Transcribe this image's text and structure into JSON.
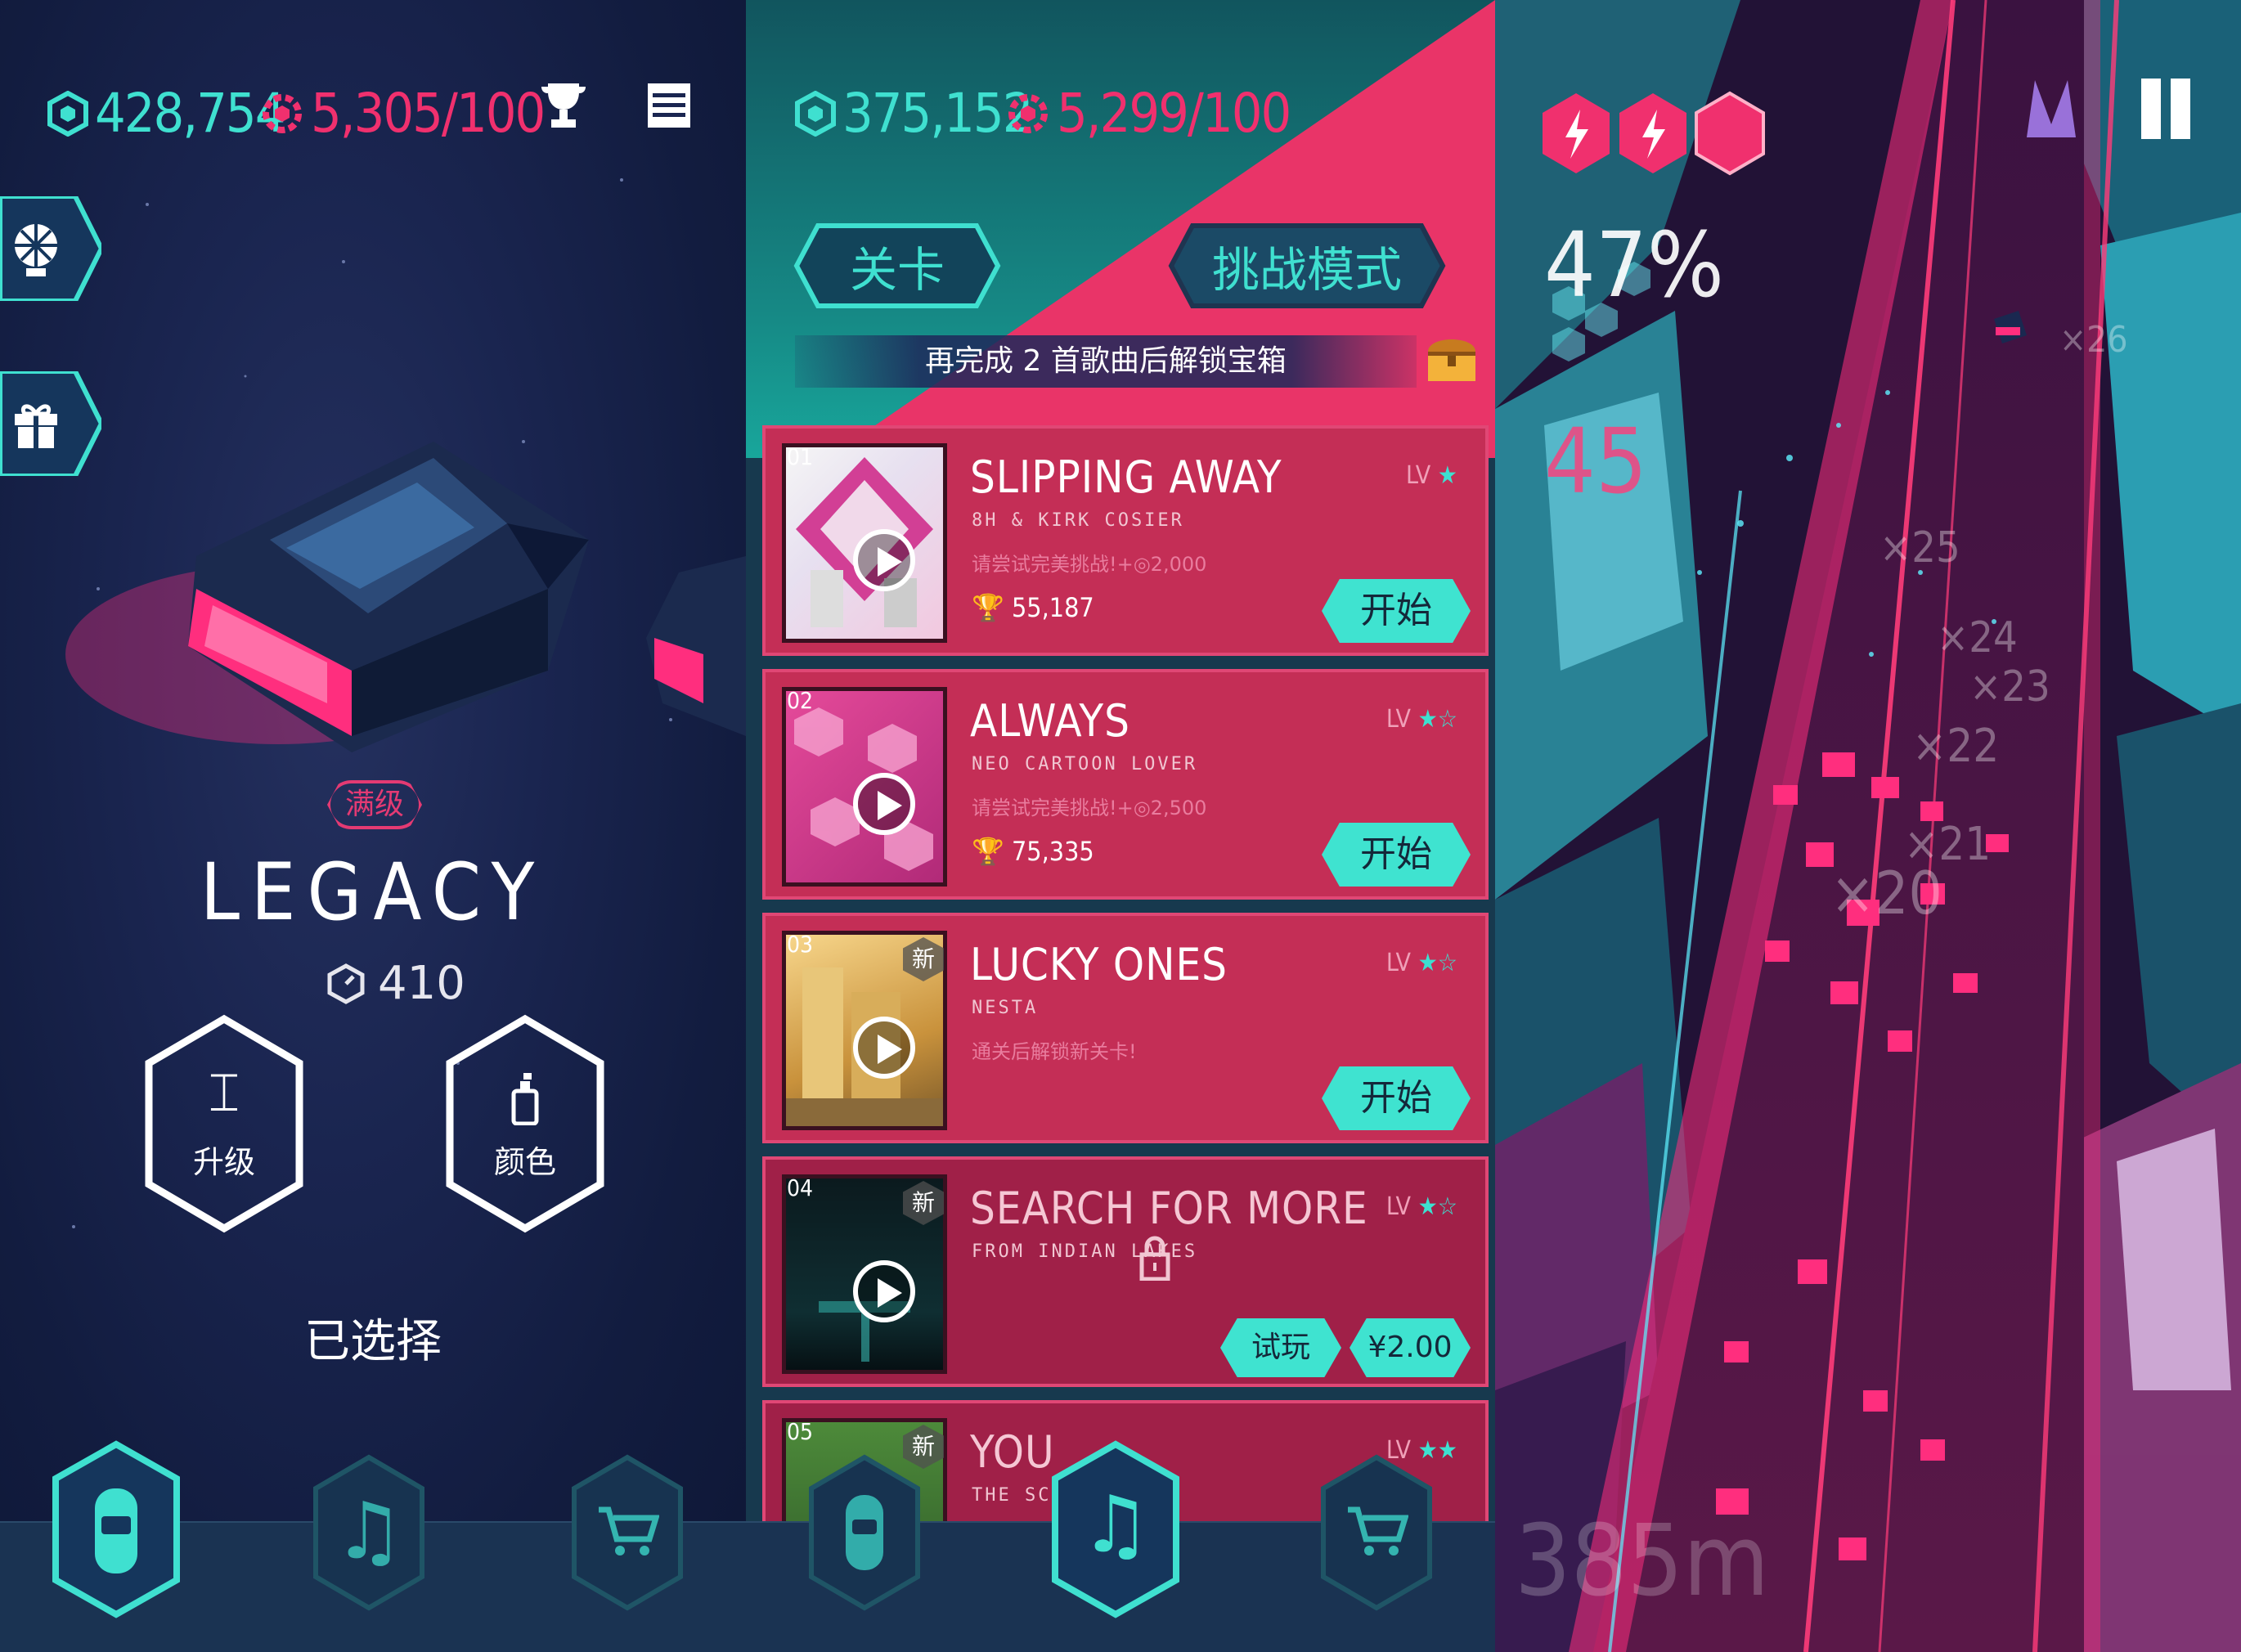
{
  "panel1": {
    "coins": "428,754",
    "gems": "5,305/100",
    "trophy_icon": "trophy-icon",
    "menu_icon": "list-menu-icon",
    "side_buttons": [
      "wheel-of-fortune-icon",
      "gift-icon"
    ],
    "car_level_badge": "满级",
    "car_name": "LEGACY",
    "car_speed": "410",
    "upgrade_label": "升级",
    "color_label": "颜色",
    "selected_label": "已选择",
    "nav": [
      "car-icon",
      "music-note-icon",
      "shopping-cart-icon"
    ]
  },
  "panel2": {
    "coins": "375,152",
    "gems": "5,299/100",
    "tab_levels": "关卡",
    "tab_challenge": "挑战模式",
    "unlock_banner": "再完成 2 首歌曲后解锁宝箱",
    "songs": [
      {
        "num": "01",
        "title": "SLIPPING AWAY",
        "artist": "8H & KIRK COSIER",
        "challenge": "请尝试完美挑战!+◎2,000",
        "trophies": "55,187",
        "lv": "LV",
        "stars": "★",
        "action": "开始",
        "new": ""
      },
      {
        "num": "02",
        "title": "ALWAYS",
        "artist": "NEO CARTOON LOVER",
        "challenge": "请尝试完美挑战!+◎2,500",
        "trophies": "75,335",
        "lv": "LV",
        "stars": "★☆",
        "action": "开始",
        "new": ""
      },
      {
        "num": "03",
        "title": "LUCKY ONES",
        "artist": "NESTA",
        "challenge": "通关后解锁新关卡!",
        "trophies": "",
        "lv": "LV",
        "stars": "★☆",
        "action": "开始",
        "new": "新"
      },
      {
        "num": "04",
        "title": "SEARCH FOR MORE",
        "artist": "FROM INDIAN LAKES",
        "challenge": "",
        "trophies": "",
        "lv": "LV",
        "stars": "★☆",
        "try": "试玩",
        "price": "¥2.00",
        "new": "新"
      },
      {
        "num": "05",
        "title": "YOU",
        "artist": "THE SCHIZO",
        "lv": "LV",
        "stars": "★★",
        "new": "新"
      }
    ],
    "nav": [
      "car-icon",
      "music-note-icon",
      "shopping-cart-icon"
    ]
  },
  "panel3": {
    "percent": "47%",
    "combo": "45",
    "distance": "385m",
    "multipliers": [
      "×26",
      "×25",
      "×24",
      "×23",
      "×22",
      "×21",
      "×20"
    ],
    "energy": [
      "lightning-hex-icon",
      "lightning-hex-icon",
      "empty-hex-icon"
    ],
    "pause_icon": "pause-icon"
  },
  "colors": {
    "teal": "#3fe0d0",
    "pink": "#f0306e",
    "navy": "#121c3f",
    "card": "#c42e56"
  }
}
